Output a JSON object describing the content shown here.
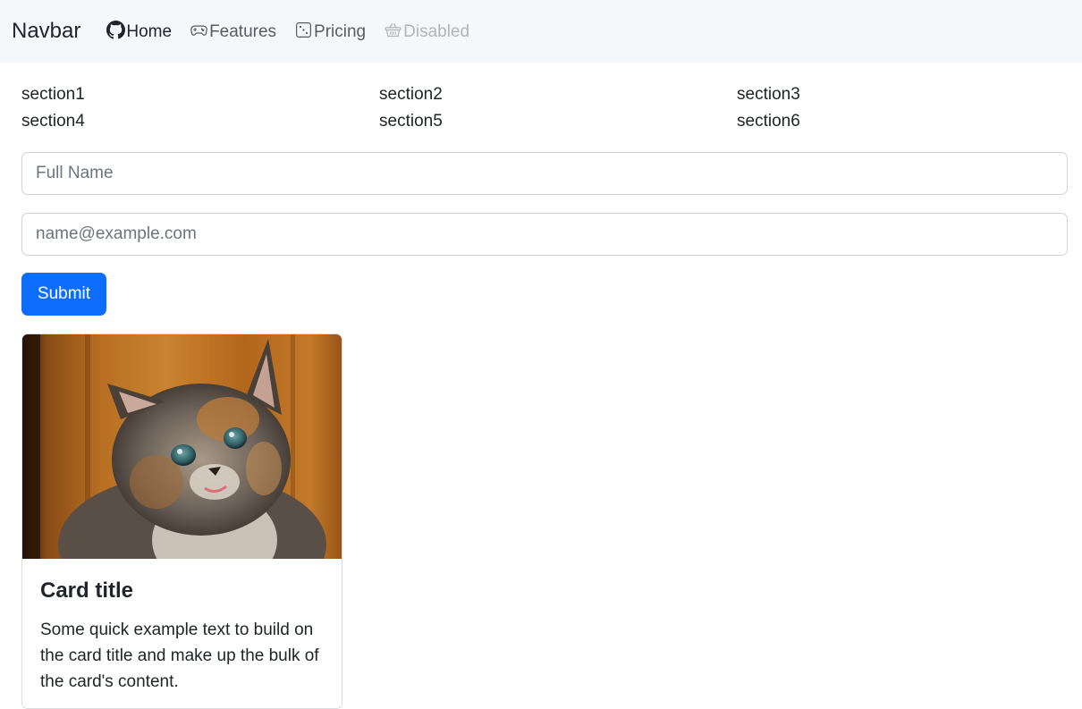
{
  "navbar": {
    "brand": "Navbar",
    "items": [
      {
        "label": "Home",
        "icon": "github-icon",
        "state": "active"
      },
      {
        "label": "Features",
        "icon": "gamepad-icon",
        "state": "normal"
      },
      {
        "label": "Pricing",
        "icon": "dice-icon",
        "state": "normal"
      },
      {
        "label": "Disabled",
        "icon": "basket-icon",
        "state": "disabled"
      }
    ]
  },
  "sections": [
    "section1",
    "section2",
    "section3",
    "section4",
    "section5",
    "section6"
  ],
  "form": {
    "name_placeholder": "Full Name",
    "email_placeholder": "name@example.com",
    "submit_label": "Submit"
  },
  "card": {
    "image": "kitten-photo",
    "title": "Card title",
    "text": "Some quick example text to build on the card title and make up the bulk of the card's content."
  },
  "colors": {
    "navbar_bg": "#f4f8fb",
    "primary": "#0d6efd",
    "text": "#212529",
    "muted": "#6c757d",
    "disabled": "#b2b4b6"
  }
}
